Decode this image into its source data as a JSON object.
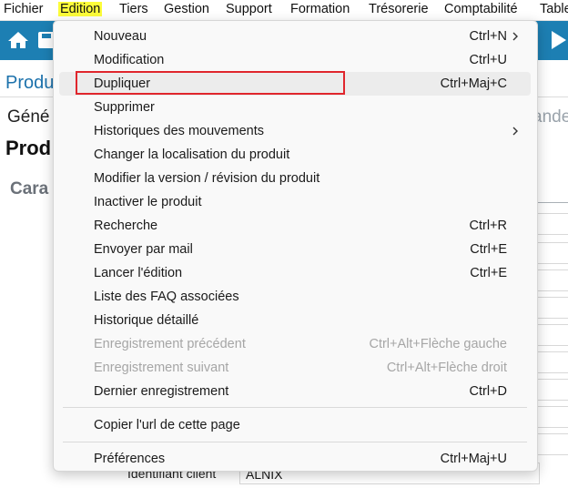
{
  "menubar": {
    "items": [
      "Fichier",
      "Edition",
      "Tiers",
      "Gestion",
      "Support",
      "Formation",
      "Trésorerie",
      "Comptabilité",
      "Table"
    ],
    "active": "Edition",
    "highlight_color": "#fdfd3a"
  },
  "toolbar": {
    "color": "#1d7fb3",
    "icons": [
      "home-icon",
      "save-icon",
      "play-icon"
    ]
  },
  "background": {
    "page_title": "Produ",
    "tab_left": "Géné",
    "tab_right": "ande",
    "heading": "Prod",
    "section": "Cara",
    "label": "Identifiant client",
    "value": "ALNIX"
  },
  "edition_menu": {
    "items": [
      {
        "label": "Nouveau",
        "shortcut": "Ctrl+N",
        "submenu": true
      },
      {
        "label": "Modification",
        "shortcut": "Ctrl+U"
      },
      {
        "label": "Dupliquer",
        "shortcut": "Ctrl+Maj+C",
        "hover": true,
        "highlighted": true
      },
      {
        "label": "Supprimer",
        "shortcut": ""
      },
      {
        "label": "Historiques des mouvements",
        "shortcut": "",
        "submenu": true
      },
      {
        "label": "Changer la localisation du produit",
        "shortcut": ""
      },
      {
        "label": "Modifier la version / révision du produit",
        "shortcut": ""
      },
      {
        "label": "Inactiver le produit",
        "shortcut": ""
      },
      {
        "label": "Recherche",
        "shortcut": "Ctrl+R"
      },
      {
        "label": "Envoyer par mail",
        "shortcut": "Ctrl+E"
      },
      {
        "label": "Lancer l'édition",
        "shortcut": "Ctrl+E"
      },
      {
        "label": "Liste des FAQ associées",
        "shortcut": ""
      },
      {
        "label": "Historique détaillé",
        "shortcut": ""
      },
      {
        "label": "Enregistrement précédent",
        "shortcut": "Ctrl+Alt+Flèche gauche",
        "disabled": true
      },
      {
        "label": "Enregistrement suivant",
        "shortcut": "Ctrl+Alt+Flèche droit",
        "disabled": true
      },
      {
        "label": "Dernier enregistrement",
        "shortcut": "Ctrl+D"
      },
      {
        "label": "Copier l'url de cette page",
        "shortcut": ""
      },
      {
        "label": "Préférences",
        "shortcut": "Ctrl+Maj+U"
      }
    ],
    "highlight_box_color": "#e0262d"
  }
}
